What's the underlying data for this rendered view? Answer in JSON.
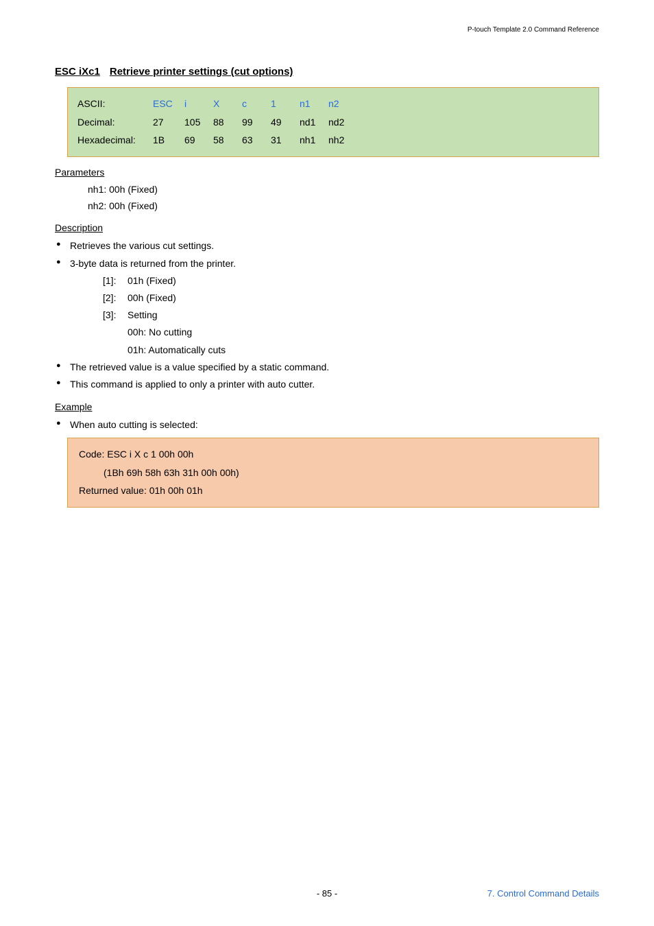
{
  "header": {
    "right": "P-touch Template 2.0 Command Reference"
  },
  "title": {
    "cmd": "ESC iXc1",
    "desc": "Retrieve printer settings (cut options)"
  },
  "codeTable": {
    "rows": [
      {
        "label": "ASCII:",
        "cells": [
          "ESC",
          "i",
          "X",
          "c",
          "1",
          "n1",
          "n2"
        ],
        "blue": true
      },
      {
        "label": "Decimal:",
        "cells": [
          "27",
          "105",
          "88",
          "99",
          "49",
          "nd1",
          "nd2"
        ],
        "blue": false
      },
      {
        "label": "Hexadecimal:",
        "cells": [
          "1B",
          "69",
          "58",
          "63",
          "31",
          "nh1",
          "nh2"
        ],
        "blue": false
      }
    ]
  },
  "parameters": {
    "head": "Parameters",
    "lines": [
      "nh1: 00h (Fixed)",
      "nh2: 00h (Fixed)"
    ]
  },
  "description": {
    "head": "Description",
    "bullets": [
      {
        "text": "Retrieves the various cut settings."
      },
      {
        "text": "3-byte data is returned from the printer.",
        "items": [
          {
            "lbl": "[1]:",
            "val": "01h (Fixed)"
          },
          {
            "lbl": "[2]:",
            "val": "00h (Fixed)"
          },
          {
            "lbl": "[3]:",
            "val": "Setting",
            "extras": [
              "00h: No cutting",
              "01h: Automatically cuts"
            ]
          }
        ]
      },
      {
        "text": "The retrieved value is a value specified by a static command."
      },
      {
        "text": "This command is applied to only a printer with auto cutter."
      }
    ]
  },
  "example": {
    "head": "Example",
    "bullet": "When auto cutting is selected:",
    "lines": [
      "Code: ESC i X c 1 00h 00h",
      "(1Bh 69h 58h 63h 31h 00h 00h)",
      "Returned value: 01h 00h 01h"
    ]
  },
  "footer": {
    "page": "- 85 -",
    "right": "7. Control Command Details"
  }
}
